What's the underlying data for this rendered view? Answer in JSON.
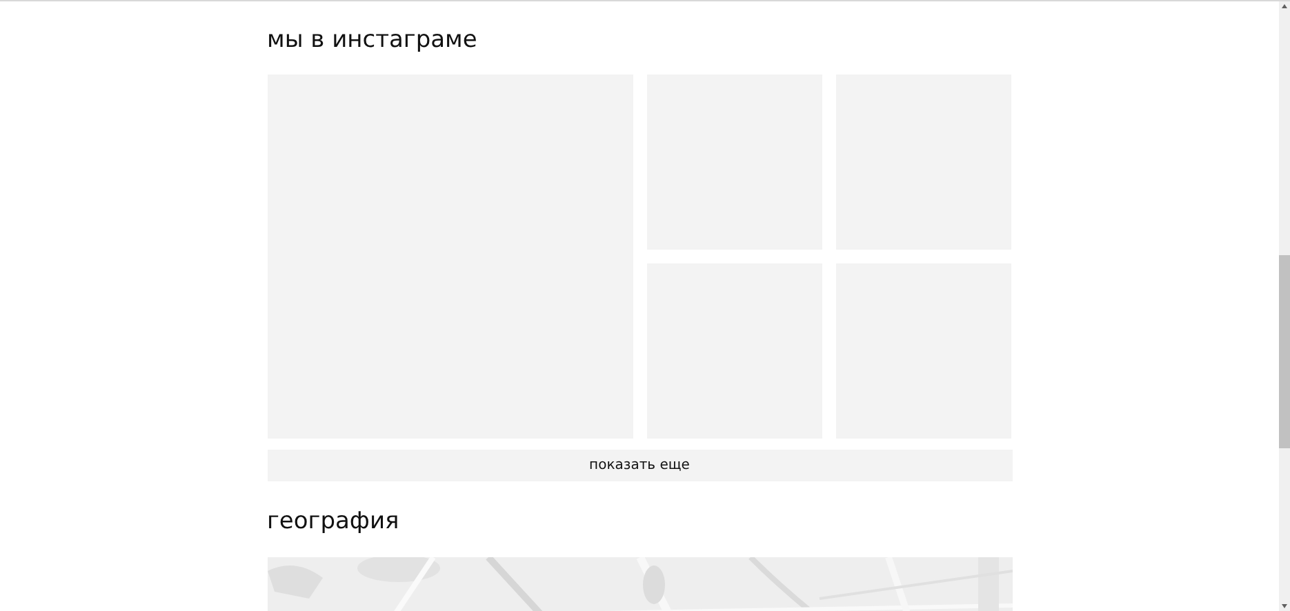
{
  "instagram": {
    "title": "мы в инстаграме",
    "more_button": "показать еще"
  },
  "geography": {
    "title": "география"
  }
}
